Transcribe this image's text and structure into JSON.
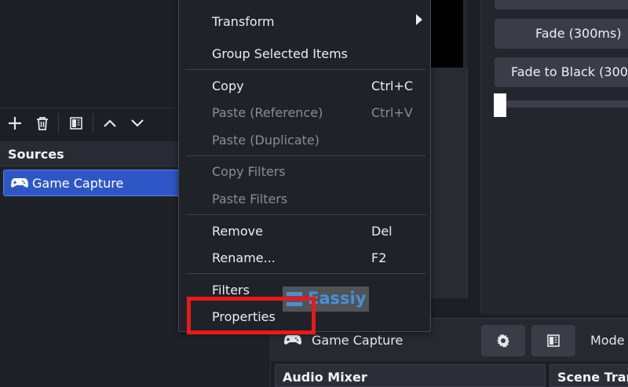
{
  "sources": {
    "title": "Sources",
    "items": [
      {
        "label": "Game Capture",
        "icon": "gamepad-icon"
      }
    ]
  },
  "scene_toolbar": {
    "icons": [
      "plus-icon",
      "trash-icon",
      "filter-icon",
      "arrow-up-icon",
      "arrow-down-icon"
    ]
  },
  "context_menu": {
    "items": [
      {
        "label": "Transform",
        "has_submenu": true,
        "enabled": true
      },
      {
        "label": "Group Selected Items",
        "enabled": true
      },
      {
        "label": "Copy",
        "shortcut": "Ctrl+C",
        "enabled": true
      },
      {
        "label": "Paste (Reference)",
        "shortcut": "Ctrl+V",
        "enabled": false
      },
      {
        "label": "Paste (Duplicate)",
        "enabled": false
      },
      {
        "label": "Copy Filters",
        "enabled": false
      },
      {
        "label": "Paste Filters",
        "enabled": false
      },
      {
        "label": "Remove",
        "shortcut": "Del",
        "enabled": true
      },
      {
        "label": "Rename...",
        "shortcut": "F2",
        "enabled": true
      },
      {
        "label": "Filters",
        "enabled": true
      },
      {
        "label": "Properties",
        "enabled": true,
        "highlighted": true
      }
    ]
  },
  "transitions": {
    "fade_label": "Fade (300ms)",
    "fade_black_label": "Fade to Black (300m"
  },
  "context_bar": {
    "source_name": "Game Capture",
    "mode_label": "Mode"
  },
  "docks": {
    "audio_mixer": "Audio Mixer",
    "scene_transitions": "Scene Trans"
  },
  "watermark": {
    "text": "Eassiy"
  },
  "colors": {
    "accent_selection": "#2f56c6",
    "highlight": "#e8191c",
    "menu_bg": "#202229"
  }
}
